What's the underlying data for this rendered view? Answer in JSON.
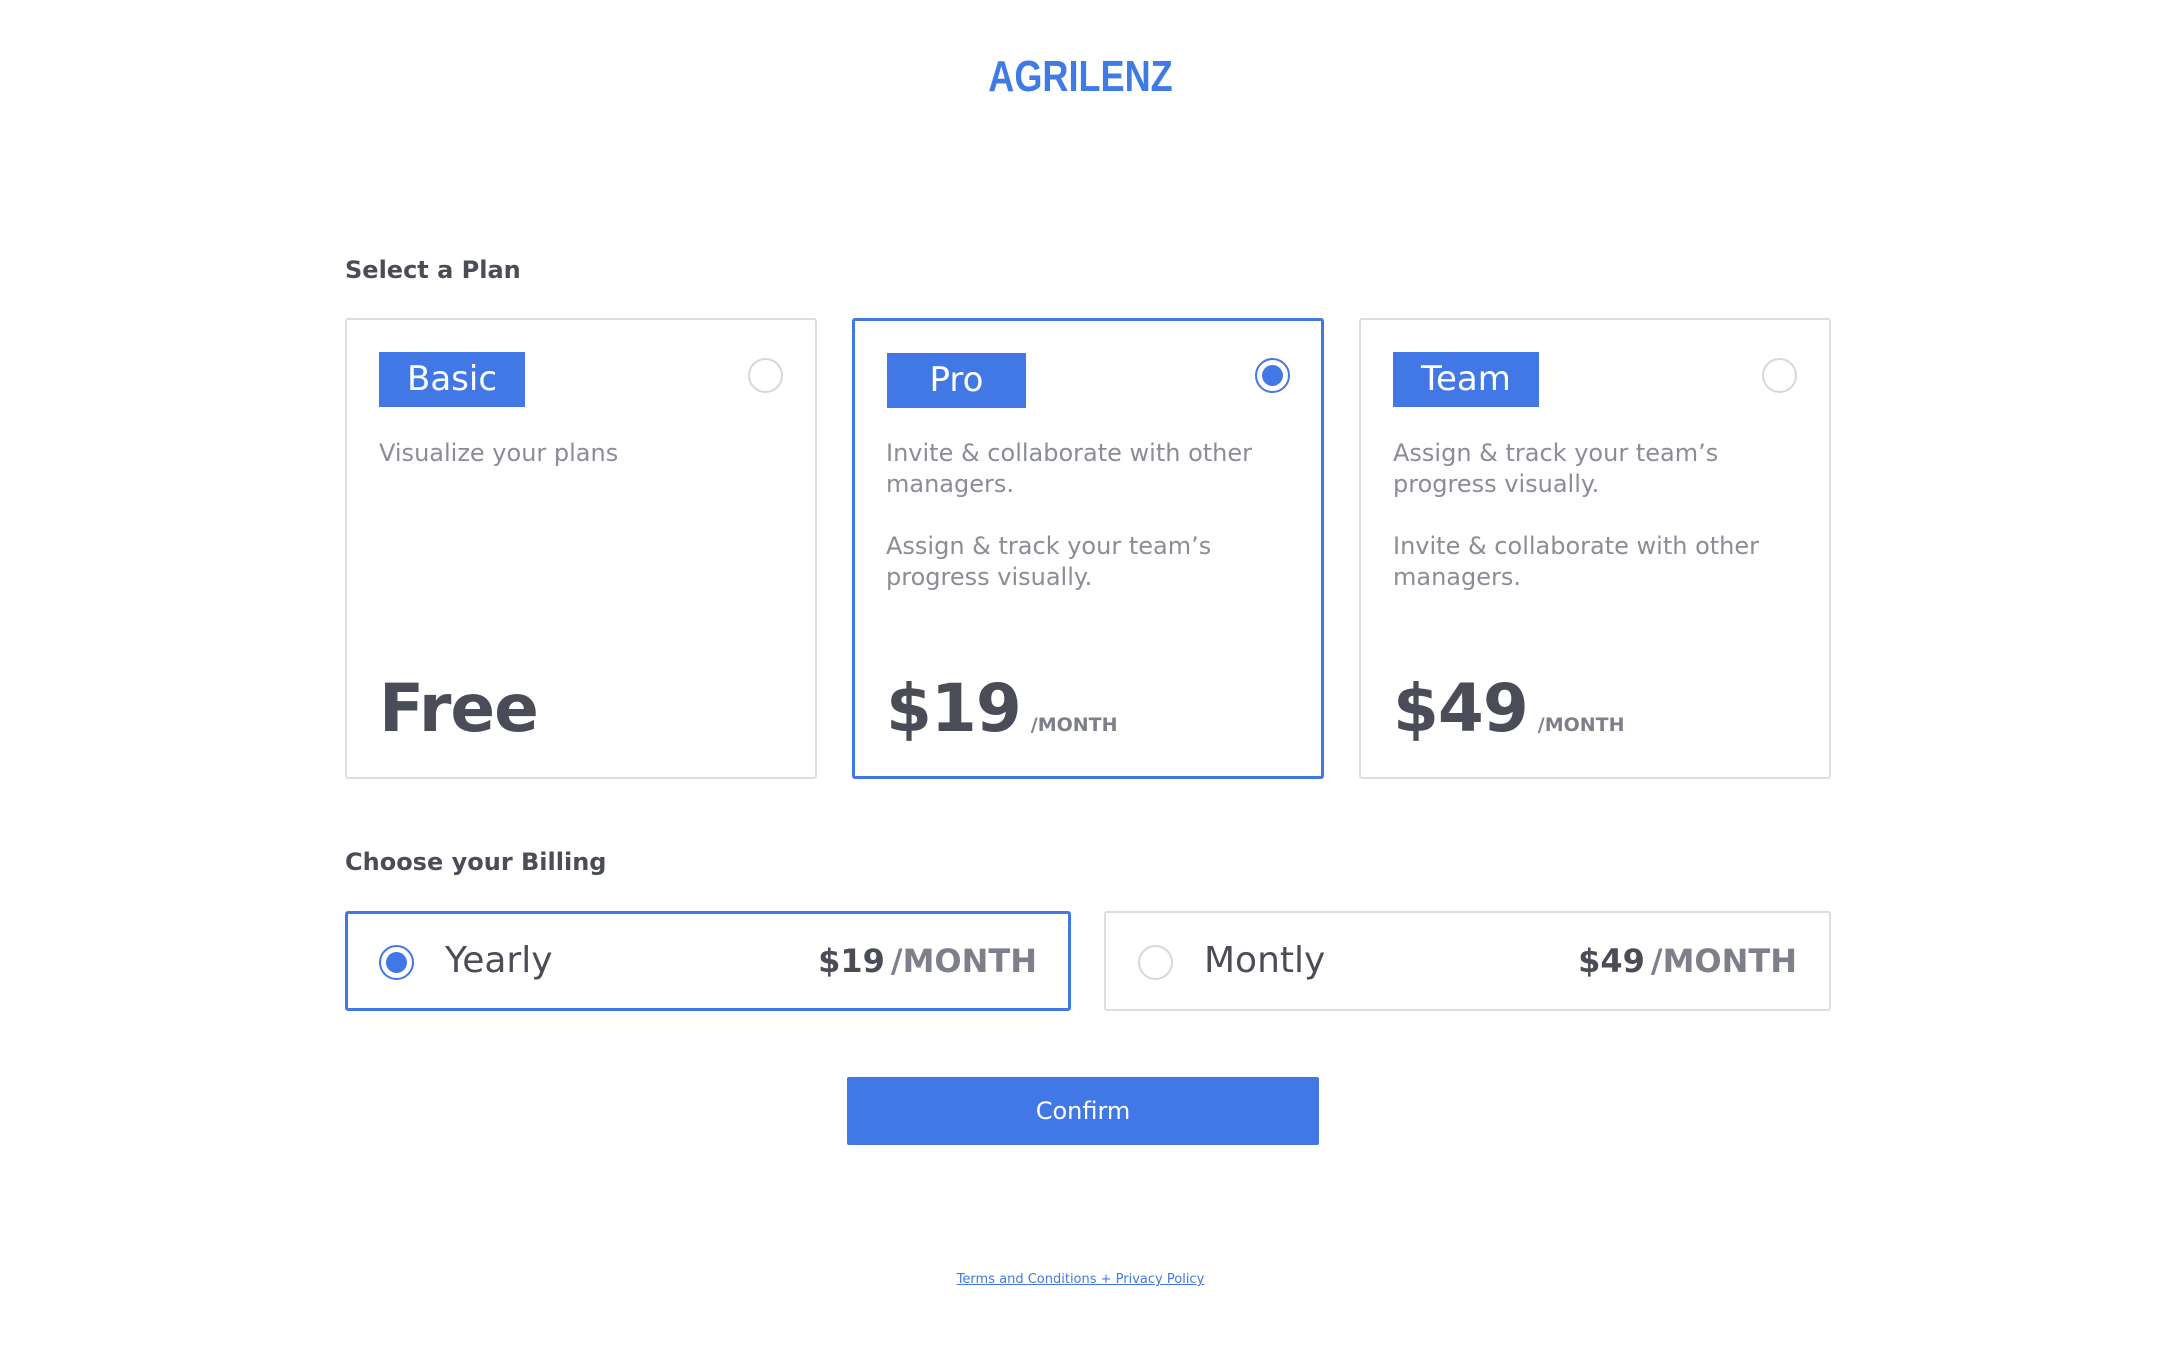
{
  "brand": {
    "logo": "AGRILENZ",
    "accent": "#4178e6"
  },
  "plan_section": {
    "title": "Select a Plan",
    "plans": [
      {
        "name": "Basic",
        "descriptions": [
          "Visualize your plans"
        ],
        "price": "Free",
        "per": "",
        "selected": false
      },
      {
        "name": "Pro",
        "descriptions": [
          "Invite & collaborate with other managers.",
          "Assign & track your team’s progress visually."
        ],
        "price": "$19",
        "per": "/MONTH",
        "selected": true
      },
      {
        "name": "Team",
        "descriptions": [
          "Assign & track your team’s progress visually.",
          "Invite & collaborate with other managers."
        ],
        "price": "$49",
        "per": "/MONTH",
        "selected": false
      }
    ]
  },
  "billing_section": {
    "title": "Choose your Billing",
    "options": [
      {
        "label": "Yearly",
        "price": "$19",
        "unit": "/MONTH",
        "selected": true
      },
      {
        "label": "Montly",
        "price": "$49",
        "unit": "/MONTH",
        "selected": false
      }
    ]
  },
  "confirm_label": "Confirm",
  "footer": {
    "link_text": "Terms and Conditions + Privacy Policy"
  }
}
